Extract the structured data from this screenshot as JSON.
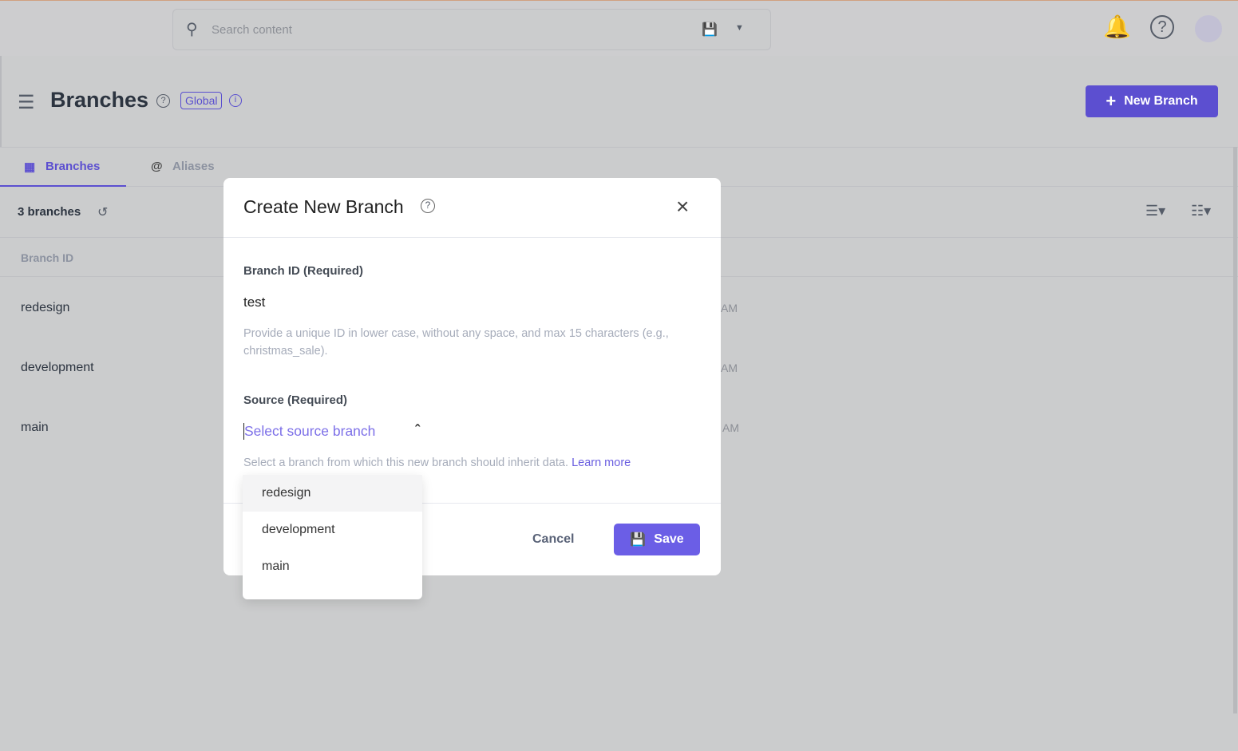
{
  "topbar": {
    "search_placeholder": "Search content"
  },
  "header": {
    "title": "Branches",
    "badge": "Global",
    "new_button": "New Branch"
  },
  "tabs": [
    {
      "label": "Branches",
      "active": true
    },
    {
      "label": "Aliases",
      "active": false
    }
  ],
  "list": {
    "count_label": "3 branches",
    "column_header": "Branch ID",
    "rows": [
      {
        "id": "redesign",
        "time_suffix": "AM"
      },
      {
        "id": "development",
        "time_suffix": "AM"
      },
      {
        "id": "main",
        "time_suffix": "AM"
      }
    ]
  },
  "modal": {
    "title": "Create New Branch",
    "branch_id_label": "Branch ID (Required)",
    "branch_id_value": "test",
    "branch_id_hint": "Provide a unique ID in lower case, without any space, and max 15 characters (e.g., christmas_sale).",
    "source_label": "Source (Required)",
    "source_placeholder": "Select source branch",
    "source_hint": "Select a branch from which this new branch should inherit data.",
    "learn_more": "Learn more",
    "cancel": "Cancel",
    "save": "Save",
    "options": [
      "redesign",
      "development",
      "main"
    ]
  },
  "colors": {
    "accent": "#5c4fd0",
    "overlay": "#cbcccd"
  }
}
